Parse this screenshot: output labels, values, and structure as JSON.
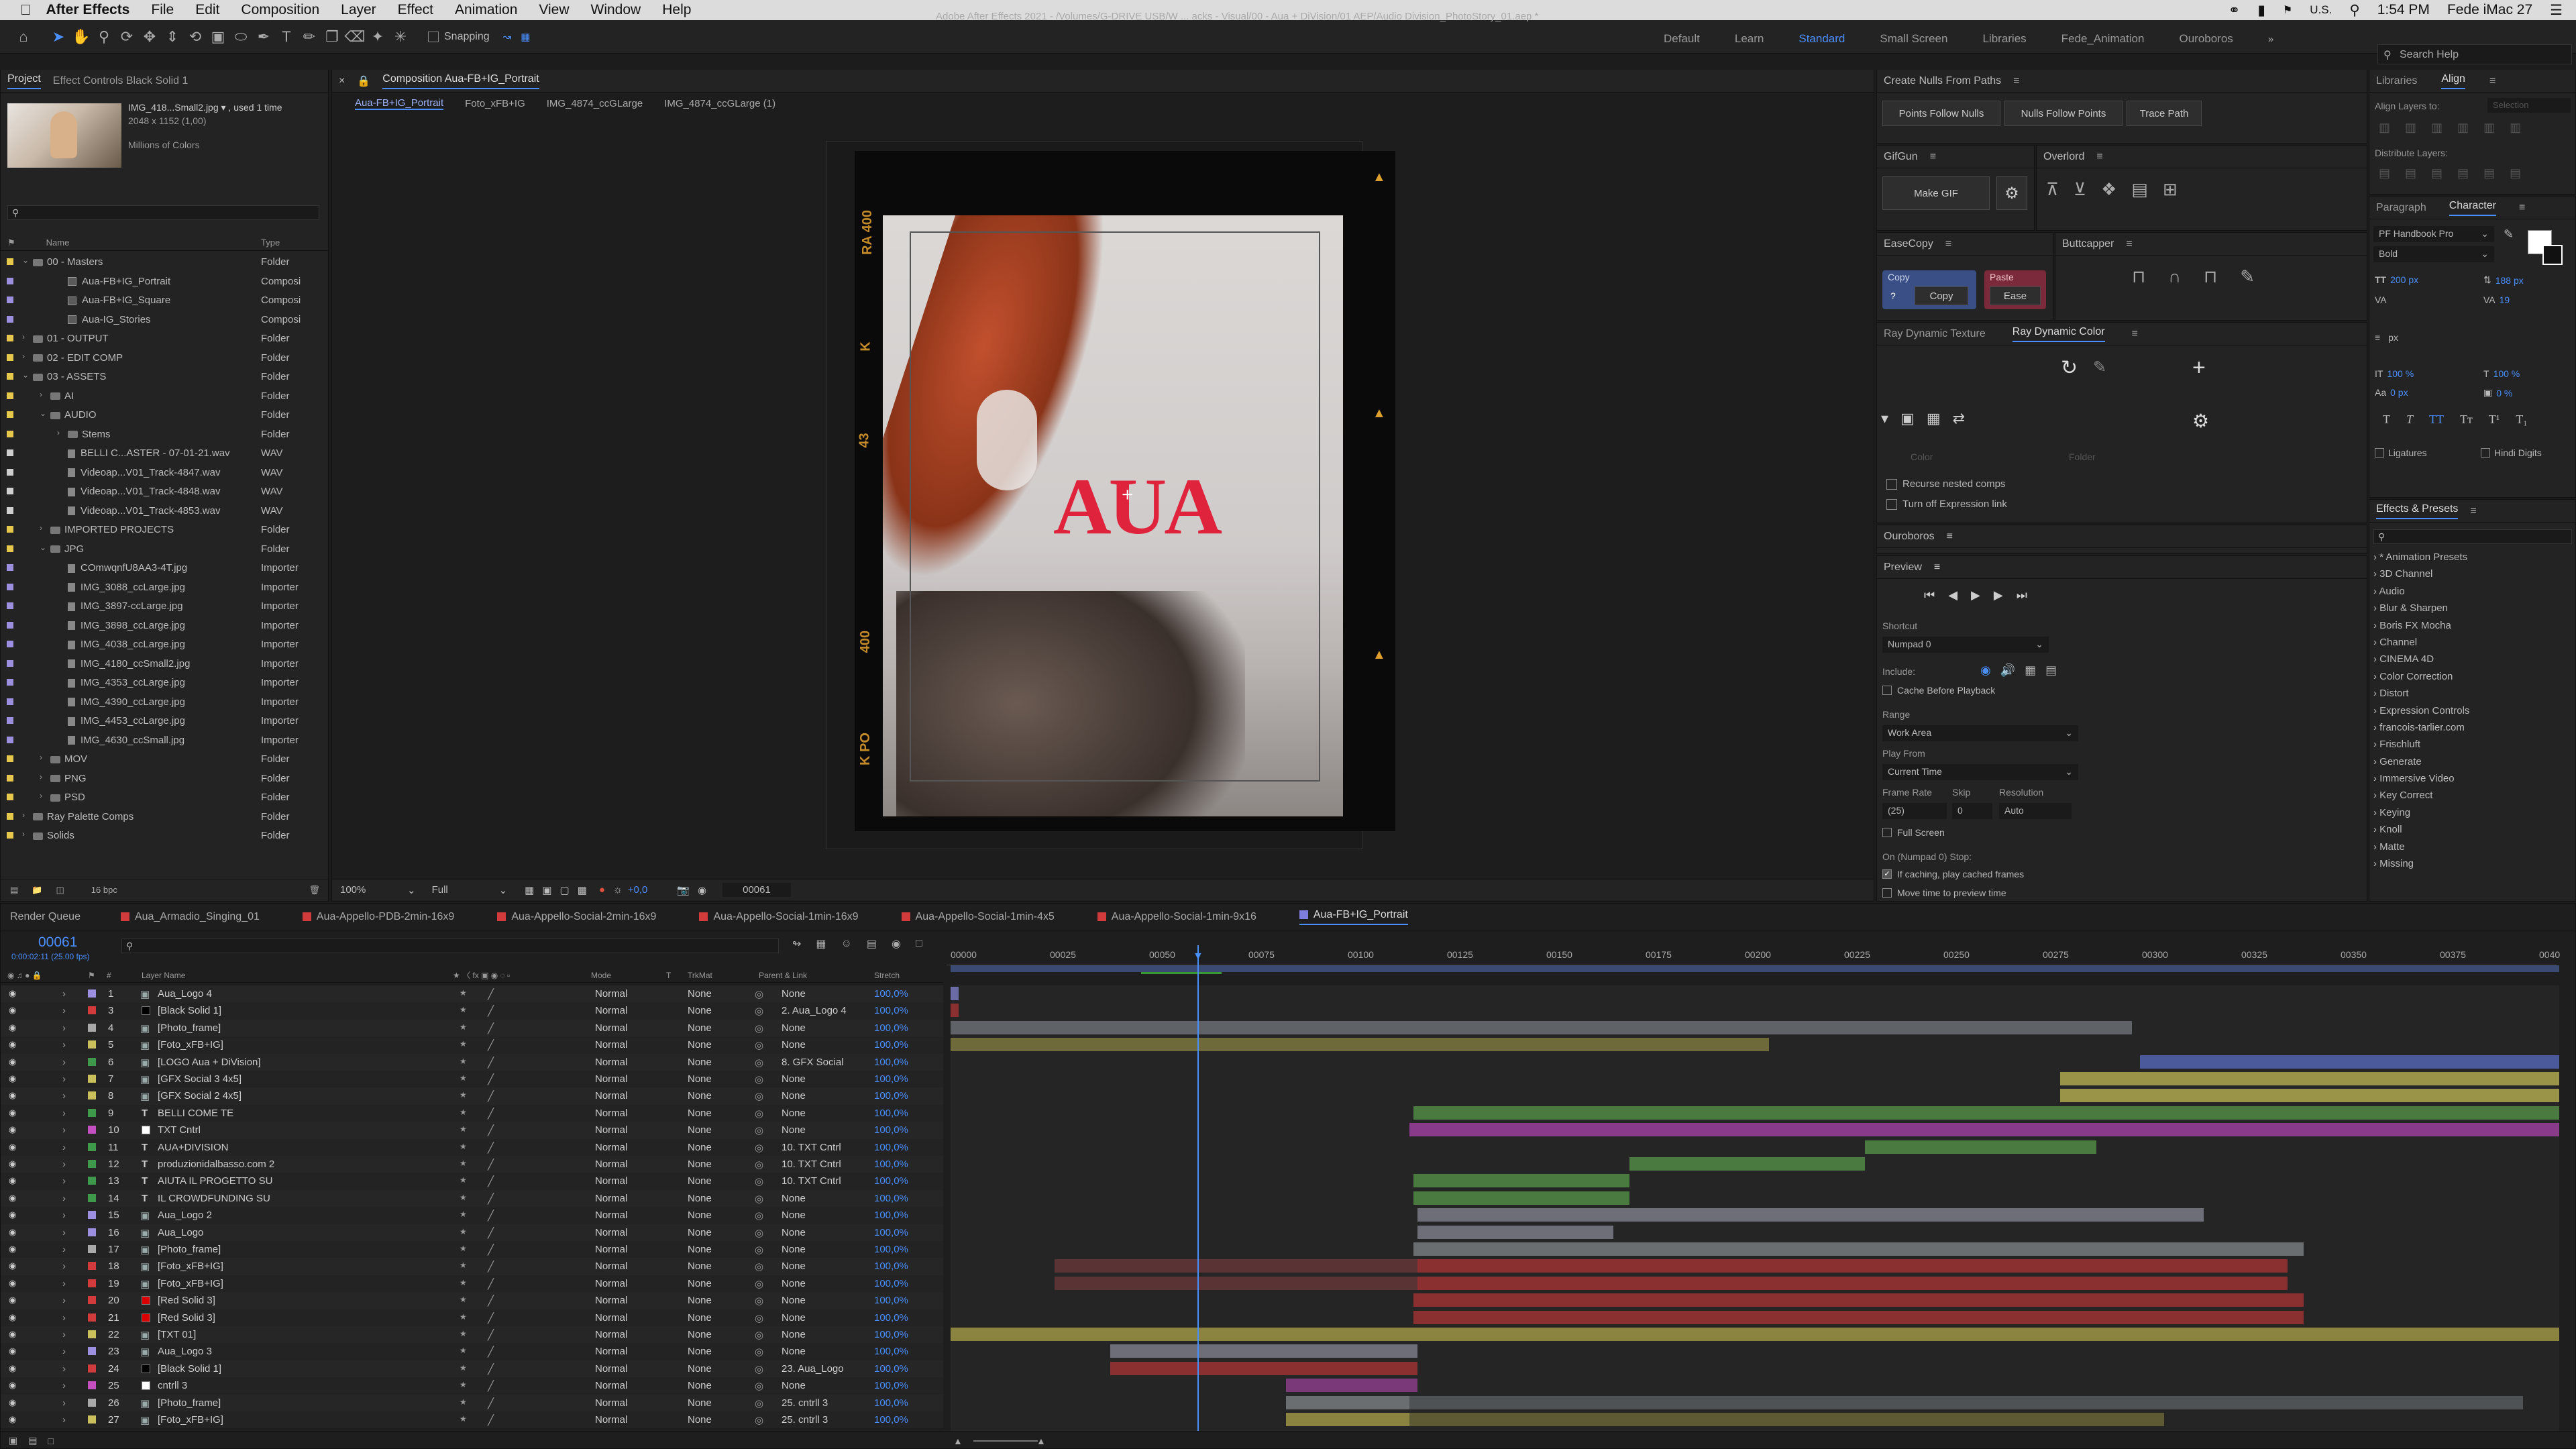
{
  "menubar": {
    "app": "After Effects",
    "items": [
      "File",
      "Edit",
      "Composition",
      "Layer",
      "Effect",
      "Animation",
      "View",
      "Window",
      "Help"
    ],
    "locale": "U.S.",
    "time": "1:54 PM",
    "user": "Fede iMac 27"
  },
  "toolbar": {
    "snapping": "Snapping",
    "title": "Adobe After Effects 2021 - /Volumes/G-DRIVE USB/W ... acks - Visual/00 - Aua + DiVision/01 AEP/Audio Division_PhotoStory_01.aep *",
    "workspaces": [
      "Default",
      "Learn",
      "Standard",
      "Small Screen",
      "Libraries",
      "Fede_Animation",
      "Ouroboros"
    ],
    "search": "Search Help"
  },
  "project": {
    "tabs": [
      "Project",
      "Effect Controls Black Solid 1"
    ],
    "footage_name": "IMG_418...Small2.jpg ▾ , used 1 time",
    "footage_size": "2048 x 1152 (1,00)",
    "footage_colors": "Millions of Colors",
    "col_name": "Name",
    "col_type": "Type",
    "bpc": "16 bpc",
    "rows": [
      {
        "name": "00 - Masters",
        "type": "Folder",
        "indent": 0,
        "kind": "folder",
        "exp": "⌄",
        "color": "#e6c84a"
      },
      {
        "name": "Aua-FB+IG_Portrait",
        "type": "Composi",
        "indent": 2,
        "kind": "comp",
        "color": "#9d8fe0"
      },
      {
        "name": "Aua-FB+IG_Square",
        "type": "Composi",
        "indent": 2,
        "kind": "comp",
        "color": "#9d8fe0"
      },
      {
        "name": "Aua-IG_Stories",
        "type": "Composi",
        "indent": 2,
        "kind": "comp",
        "color": "#9d8fe0"
      },
      {
        "name": "01 - OUTPUT",
        "type": "Folder",
        "indent": 0,
        "kind": "folder",
        "exp": "›",
        "color": "#e6c84a"
      },
      {
        "name": "02 - EDIT COMP",
        "type": "Folder",
        "indent": 0,
        "kind": "folder",
        "exp": "›",
        "color": "#e6c84a"
      },
      {
        "name": "03 - ASSETS",
        "type": "Folder",
        "indent": 0,
        "kind": "folder",
        "exp": "⌄",
        "color": "#e6c84a"
      },
      {
        "name": "AI",
        "type": "Folder",
        "indent": 1,
        "kind": "folder",
        "exp": "›",
        "color": "#e6c84a"
      },
      {
        "name": "AUDIO",
        "type": "Folder",
        "indent": 1,
        "kind": "folder",
        "exp": "⌄",
        "color": "#e6c84a"
      },
      {
        "name": "Stems",
        "type": "Folder",
        "indent": 2,
        "kind": "folder",
        "exp": "›",
        "color": "#e6c84a"
      },
      {
        "name": "BELLI C...ASTER - 07-01-21.wav",
        "type": "WAV",
        "indent": 2,
        "kind": "file",
        "color": "#cfcfcf"
      },
      {
        "name": "Videoap...V01_Track-4847.wav",
        "type": "WAV",
        "indent": 2,
        "kind": "file",
        "color": "#cfcfcf"
      },
      {
        "name": "Videoap...V01_Track-4848.wav",
        "type": "WAV",
        "indent": 2,
        "kind": "file",
        "color": "#cfcfcf"
      },
      {
        "name": "Videoap...V01_Track-4853.wav",
        "type": "WAV",
        "indent": 2,
        "kind": "file",
        "color": "#cfcfcf"
      },
      {
        "name": "IMPORTED PROJECTS",
        "type": "Folder",
        "indent": 1,
        "kind": "folder",
        "exp": "›",
        "color": "#e6c84a"
      },
      {
        "name": "JPG",
        "type": "Folder",
        "indent": 1,
        "kind": "folder",
        "exp": "⌄",
        "color": "#e6c84a"
      },
      {
        "name": "COmwqnfU8AA3-4T.jpg",
        "type": "Importer",
        "indent": 2,
        "kind": "file",
        "color": "#9d8fe0"
      },
      {
        "name": "IMG_3088_ccLarge.jpg",
        "type": "Importer",
        "indent": 2,
        "kind": "file",
        "color": "#9d8fe0"
      },
      {
        "name": "IMG_3897-ccLarge.jpg",
        "type": "Importer",
        "indent": 2,
        "kind": "file",
        "color": "#9d8fe0"
      },
      {
        "name": "IMG_3898_ccLarge.jpg",
        "type": "Importer",
        "indent": 2,
        "kind": "file",
        "color": "#9d8fe0"
      },
      {
        "name": "IMG_4038_ccLarge.jpg",
        "type": "Importer",
        "indent": 2,
        "kind": "file",
        "color": "#9d8fe0"
      },
      {
        "name": "IMG_4180_ccSmall2.jpg",
        "type": "Importer",
        "indent": 2,
        "kind": "file",
        "color": "#9d8fe0"
      },
      {
        "name": "IMG_4353_ccLarge.jpg",
        "type": "Importer",
        "indent": 2,
        "kind": "file",
        "color": "#9d8fe0"
      },
      {
        "name": "IMG_4390_ccLarge.jpg",
        "type": "Importer",
        "indent": 2,
        "kind": "file",
        "color": "#9d8fe0"
      },
      {
        "name": "IMG_4453_ccLarge.jpg",
        "type": "Importer",
        "indent": 2,
        "kind": "file",
        "color": "#9d8fe0"
      },
      {
        "name": "IMG_4630_ccSmall.jpg",
        "type": "Importer",
        "indent": 2,
        "kind": "file",
        "color": "#9d8fe0"
      },
      {
        "name": "MOV",
        "type": "Folder",
        "indent": 1,
        "kind": "folder",
        "exp": "›",
        "color": "#e6c84a"
      },
      {
        "name": "PNG",
        "type": "Folder",
        "indent": 1,
        "kind": "folder",
        "exp": "›",
        "color": "#e6c84a"
      },
      {
        "name": "PSD",
        "type": "Folder",
        "indent": 1,
        "kind": "folder",
        "exp": "›",
        "color": "#e6c84a"
      },
      {
        "name": "Ray Palette Comps",
        "type": "Folder",
        "indent": 0,
        "kind": "folder",
        "exp": "›",
        "color": "#e6c84a"
      },
      {
        "name": "Solids",
        "type": "Folder",
        "indent": 0,
        "kind": "folder",
        "exp": "›",
        "color": "#e6c84a"
      }
    ]
  },
  "comp": {
    "tab": "Composition Aua-FB+IG_Portrait",
    "crumbs": [
      "Aua-FB+IG_Portrait",
      "Foto_xFB+IG",
      "IMG_4874_ccGLarge",
      "IMG_4874_ccGLarge (1)"
    ],
    "zoom": "100%",
    "resolution": "Full",
    "exposure": "+0,0",
    "timecode": "00061",
    "logo": "AUA",
    "film_left": [
      "RA 400",
      "K",
      "43",
      "400",
      "K PO"
    ]
  },
  "right": {
    "create_nulls": {
      "title": "Create Nulls From Paths",
      "buttons": [
        "Points Follow Nulls",
        "Nulls Follow Points",
        "Trace Path"
      ]
    },
    "gifgun": {
      "title": "GifGun",
      "button": "Make GIF"
    },
    "overlord": {
      "title": "Overlord"
    },
    "easecopy": {
      "title": "EaseCopy",
      "copy_label": "Copy",
      "copy_btn": "Copy",
      "paste_label": "Paste",
      "paste_btn": "Ease",
      "q": "?"
    },
    "buttcapper": {
      "title": "Buttcapper"
    },
    "ray": {
      "tabs": [
        "Ray Dynamic Texture",
        "Ray Dynamic Color"
      ],
      "color_lbl": "Color",
      "folder_lbl": "Folder",
      "cb1": "Recurse nested comps",
      "cb2": "Turn off Expression link"
    },
    "ouroboros": {
      "title": "Ouroboros"
    },
    "preview": {
      "title": "Preview",
      "shortcut_lbl": "Shortcut",
      "shortcut": "Numpad 0",
      "include_lbl": "Include:",
      "cache": "Cache Before Playback",
      "range_lbl": "Range",
      "range": "Work Area",
      "play_lbl": "Play From",
      "play": "Current Time",
      "fr_lbl": "Frame Rate",
      "skip_lbl": "Skip",
      "res_lbl": "Resolution",
      "fr": "(25)",
      "skip": "0",
      "res": "Auto",
      "full": "Full Screen",
      "stop_lbl": "On (Numpad 0) Stop:",
      "stop1": "If caching, play cached frames",
      "stop2": "Move time to preview time"
    },
    "libraries": {
      "tabs": [
        "Libraries",
        "Align"
      ],
      "align_to": "Align Layers to:",
      "selection": "Selection",
      "distribute": "Distribute Layers:"
    },
    "character": {
      "tabs": [
        "Paragraph",
        "Character"
      ],
      "font": "PF Handbook Pro",
      "style": "Bold",
      "size": "200 px",
      "leading": "188 px",
      "tracking": "19",
      "kern_unit": "px",
      "scale_v": "100 %",
      "scale_h": "100 %",
      "baseline": "0 px",
      "tsume": "0 %",
      "ligatures": "Ligatures",
      "hindi": "Hindi Digits"
    },
    "effects": {
      "title": "Effects & Presets",
      "items": [
        "* Animation Presets",
        "3D Channel",
        "Audio",
        "Blur & Sharpen",
        "Boris FX Mocha",
        "Channel",
        "CINEMA 4D",
        "Color Correction",
        "Distort",
        "Expression Controls",
        "francois-tarlier.com",
        "Frischluft",
        "Generate",
        "Immersive Video",
        "Key Correct",
        "Keying",
        "Knoll",
        "Matte",
        "Missing"
      ]
    }
  },
  "timeline": {
    "tabs": [
      "Render Queue",
      "Aua_Armadio_Singing_01",
      "Aua-Appello-PDB-2min-16x9",
      "Aua-Appello-Social-2min-16x9",
      "Aua-Appello-Social-1min-16x9",
      "Aua-Appello-Social-1min-4x5",
      "Aua-Appello-Social-1min-9x16",
      "Aua-FB+IG_Portrait"
    ],
    "tab_colors": [
      "#777",
      "#d23b3b",
      "#d23b3b",
      "#d23b3b",
      "#d23b3b",
      "#d23b3b",
      "#d23b3b",
      "#7d7dde"
    ],
    "timecode": "00061",
    "fps": "0:00:02:11 (25.00 fps)",
    "headers": {
      "layer": "Layer Name",
      "mode": "Mode",
      "t": "T",
      "trk": "TrkMat",
      "parent": "Parent & Link",
      "stretch": "Stretch"
    },
    "ruler": [
      "00000",
      "00025",
      "00050",
      "00075",
      "00100",
      "00125",
      "00150",
      "00175",
      "00200",
      "00225",
      "00250",
      "00275",
      "00300",
      "00325",
      "00350",
      "00375",
      "0040"
    ],
    "layers": [
      {
        "n": "1",
        "name": "Aua_Logo 4",
        "lc": "#9d8fe0",
        "ic": "comp",
        "parent": "None",
        "mode": "Normal",
        "trk": "None",
        "stretch": "100,0%",
        "bars": [
          {
            "s": 0,
            "e": 2,
            "c": "#6b6ba6"
          }
        ]
      },
      {
        "n": "3",
        "name": "[Black Solid 1]",
        "lc": "#d23b3b",
        "ic": "solid-black",
        "parent": "2. Aua_Logo 4",
        "mode": "Normal",
        "trk": "None",
        "stretch": "100,0%",
        "bars": [
          {
            "s": 0,
            "e": 2,
            "c": "#8a3030"
          }
        ]
      },
      {
        "n": "4",
        "name": "[Photo_frame]",
        "lc": "#a9a9a9",
        "ic": "comp",
        "parent": "None",
        "mode": "Normal",
        "trk": "None",
        "stretch": "100,0%",
        "bars": [
          {
            "s": 0,
            "e": 296,
            "c": "#5f6368"
          }
        ]
      },
      {
        "n": "5",
        "name": "[Foto_xFB+IG]",
        "lc": "#c9bf5b",
        "ic": "comp",
        "parent": "None",
        "mode": "Normal",
        "trk": "None",
        "stretch": "100,0%",
        "bars": [
          {
            "s": 0,
            "e": 205,
            "c": "#6e6a3a"
          }
        ]
      },
      {
        "n": "6",
        "name": "[LOGO Aua + DiVision]",
        "lc": "#3e9a4a",
        "ic": "comp",
        "parent": "8. GFX Social",
        "mode": "Normal",
        "trk": "None",
        "stretch": "100,0%",
        "bars": [
          {
            "s": 298,
            "e": 403,
            "c": "#4a5a9a"
          }
        ]
      },
      {
        "n": "7",
        "name": "[GFX Social 3 4x5]",
        "lc": "#c9bf5b",
        "ic": "comp",
        "parent": "None",
        "mode": "Normal",
        "trk": "None",
        "stretch": "100,0%",
        "bars": [
          {
            "s": 278,
            "e": 403,
            "c": "#9a9448"
          }
        ]
      },
      {
        "n": "8",
        "name": "[GFX Social 2 4x5]",
        "lc": "#c9bf5b",
        "ic": "comp",
        "parent": "None",
        "mode": "Normal",
        "trk": "None",
        "stretch": "100,0%",
        "bars": [
          {
            "s": 278,
            "e": 403,
            "c": "#9a9448"
          }
        ]
      },
      {
        "n": "9",
        "name": "BELLI COME TE",
        "lc": "#3e9a4a",
        "ic": "text",
        "parent": "None",
        "mode": "Normal",
        "trk": "None",
        "stretch": "100,0%",
        "bars": [
          {
            "s": 116,
            "e": 403,
            "c": "#4a7a40"
          }
        ]
      },
      {
        "n": "10",
        "name": "TXT Cntrl",
        "lc": "#c44fc0",
        "ic": "solid-white",
        "parent": "None",
        "mode": "Normal",
        "trk": "None",
        "stretch": "100,0%",
        "bars": [
          {
            "s": 115,
            "e": 403,
            "c": "#8a3a8a"
          }
        ]
      },
      {
        "n": "11",
        "name": "AUA+DIVISION",
        "lc": "#3e9a4a",
        "ic": "text",
        "parent": "10. TXT Cntrl",
        "mode": "Normal",
        "trk": "None",
        "stretch": "100,0%",
        "bars": [
          {
            "s": 229,
            "e": 287,
            "c": "#4a7a40"
          }
        ]
      },
      {
        "n": "12",
        "name": "produzionidalbasso.com 2",
        "lc": "#3e9a4a",
        "ic": "text",
        "parent": "10. TXT Cntrl",
        "mode": "Normal",
        "trk": "None",
        "stretch": "100,0%",
        "bars": [
          {
            "s": 170,
            "e": 229,
            "c": "#4a7a40"
          }
        ]
      },
      {
        "n": "13",
        "name": "AIUTA IL PROGETTO SU",
        "lc": "#3e9a4a",
        "ic": "text",
        "parent": "10. TXT Cntrl",
        "mode": "Normal",
        "trk": "None",
        "stretch": "100,0%",
        "bars": [
          {
            "s": 116,
            "e": 170,
            "c": "#4a7a40"
          }
        ]
      },
      {
        "n": "14",
        "name": "IL CROWDFUNDING SU",
        "lc": "#3e9a4a",
        "ic": "text",
        "parent": "None",
        "mode": "Normal",
        "trk": "None",
        "stretch": "100,0%",
        "bars": [
          {
            "s": 116,
            "e": 170,
            "c": "#4a7a40"
          }
        ]
      },
      {
        "n": "15",
        "name": "Aua_Logo 2",
        "lc": "#9d8fe0",
        "ic": "comp",
        "parent": "None",
        "mode": "Normal",
        "trk": "None",
        "stretch": "100,0%",
        "bars": [
          {
            "s": 117,
            "e": 314,
            "c": "#6e6e78"
          }
        ]
      },
      {
        "n": "16",
        "name": "Aua_Logo",
        "lc": "#9d8fe0",
        "ic": "comp",
        "parent": "None",
        "mode": "Normal",
        "trk": "None",
        "stretch": "100,0%",
        "bars": [
          {
            "s": 117,
            "e": 166,
            "c": "#6e6e78"
          }
        ]
      },
      {
        "n": "17",
        "name": "[Photo_frame]",
        "lc": "#a9a9a9",
        "ic": "comp",
        "parent": "None",
        "mode": "Normal",
        "trk": "None",
        "stretch": "100,0%",
        "bars": [
          {
            "s": 116,
            "e": 339,
            "c": "#6a6e70"
          }
        ]
      },
      {
        "n": "18",
        "name": "[Foto_xFB+IG]",
        "lc": "#d23b3b",
        "ic": "comp",
        "parent": "None",
        "mode": "Normal",
        "trk": "None",
        "stretch": "100,0%",
        "bars": [
          {
            "s": 26,
            "e": 117,
            "c": "#5a3434"
          },
          {
            "s": 117,
            "e": 335,
            "c": "#8a3030"
          }
        ]
      },
      {
        "n": "19",
        "name": "[Foto_xFB+IG]",
        "lc": "#d23b3b",
        "ic": "comp",
        "parent": "None",
        "mode": "Normal",
        "trk": "None",
        "stretch": "100,0%",
        "bars": [
          {
            "s": 26,
            "e": 117,
            "c": "#5a3434"
          },
          {
            "s": 117,
            "e": 335,
            "c": "#8a3030"
          }
        ]
      },
      {
        "n": "20",
        "name": "[Red Solid 3]",
        "lc": "#d23b3b",
        "ic": "solid-red",
        "parent": "None",
        "mode": "Normal",
        "trk": "None",
        "stretch": "100,0%",
        "bars": [
          {
            "s": 116,
            "e": 339,
            "c": "#8a3030"
          }
        ]
      },
      {
        "n": "21",
        "name": "[Red Solid 3]",
        "lc": "#d23b3b",
        "ic": "solid-red",
        "parent": "None",
        "mode": "Normal",
        "trk": "None",
        "stretch": "100,0%",
        "bars": [
          {
            "s": 116,
            "e": 339,
            "c": "#8a3030"
          }
        ]
      },
      {
        "n": "22",
        "name": "[TXT 01]",
        "lc": "#c9bf5b",
        "ic": "comp",
        "parent": "None",
        "mode": "Normal",
        "trk": "None",
        "stretch": "100,0%",
        "bars": [
          {
            "s": 0,
            "e": 403,
            "c": "#8a8440"
          }
        ]
      },
      {
        "n": "23",
        "name": "Aua_Logo 3",
        "lc": "#9d8fe0",
        "ic": "comp",
        "parent": "None",
        "mode": "Normal",
        "trk": "None",
        "stretch": "100,0%",
        "bars": [
          {
            "s": 40,
            "e": 117,
            "c": "#6e6e78"
          }
        ]
      },
      {
        "n": "24",
        "name": "[Black Solid 1]",
        "lc": "#d23b3b",
        "ic": "solid-black",
        "parent": "23. Aua_Logo",
        "mode": "Normal",
        "trk": "None",
        "stretch": "100,0%",
        "bars": [
          {
            "s": 40,
            "e": 117,
            "c": "#8a3030"
          }
        ]
      },
      {
        "n": "25",
        "name": "cntrll 3",
        "lc": "#c44fc0",
        "ic": "solid-white",
        "parent": "None",
        "mode": "Normal",
        "trk": "None",
        "stretch": "100,0%",
        "bars": [
          {
            "s": 84,
            "e": 117,
            "c": "#7a3a7a"
          }
        ]
      },
      {
        "n": "26",
        "name": "[Photo_frame]",
        "lc": "#a9a9a9",
        "ic": "comp",
        "parent": "25. cntrll 3",
        "mode": "Normal",
        "trk": "None",
        "stretch": "100,0%",
        "bars": [
          {
            "s": 84,
            "e": 115,
            "c": "#6a6e70"
          },
          {
            "s": 115,
            "e": 394,
            "c": "#4e5254"
          }
        ]
      },
      {
        "n": "27",
        "name": "[Foto_xFB+IG]",
        "lc": "#c9bf5b",
        "ic": "comp",
        "parent": "25. cntrll 3",
        "mode": "Normal",
        "trk": "None",
        "stretch": "100,0%",
        "bars": [
          {
            "s": 84,
            "e": 115,
            "c": "#8a8440"
          },
          {
            "s": 115,
            "e": 304,
            "c": "#5e5a34"
          }
        ]
      }
    ]
  }
}
